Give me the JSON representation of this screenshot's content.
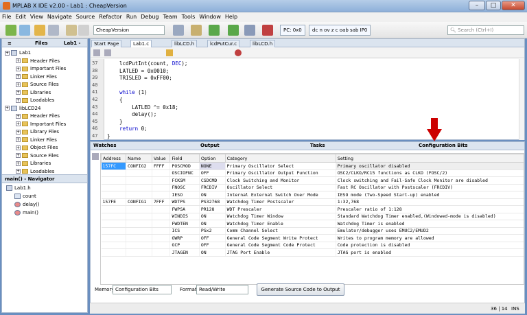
{
  "window": {
    "title": "MPLAB X IDE v2.00 - Lab1 : CheapVersion"
  },
  "menu": [
    "File",
    "Edit",
    "View",
    "Navigate",
    "Source",
    "Refactor",
    "Run",
    "Debug",
    "Team",
    "Tools",
    "Window",
    "Help"
  ],
  "toolbar": {
    "config": "CheapVersion",
    "pc": "PC: 0x0",
    "flags": "dc n ov z c oab sab IP0",
    "search_placeholder": "Search (Ctrl+I)"
  },
  "files_pane": {
    "tabs": [
      "Files",
      "Lab1 -"
    ],
    "items": [
      {
        "label": "Lab1",
        "level": 0,
        "type": "project"
      },
      {
        "label": "Header Files",
        "level": 1
      },
      {
        "label": "Important Files",
        "level": 1
      },
      {
        "label": "Linker Files",
        "level": 1
      },
      {
        "label": "Source Files",
        "level": 1
      },
      {
        "label": "Libraries",
        "level": 1
      },
      {
        "label": "Loadables",
        "level": 1
      },
      {
        "label": "libLCD24",
        "level": 0,
        "type": "project"
      },
      {
        "label": "Header Files",
        "level": 1
      },
      {
        "label": "Important Files",
        "level": 1
      },
      {
        "label": "Library Files",
        "level": 1
      },
      {
        "label": "Linker Files",
        "level": 1
      },
      {
        "label": "Object Files",
        "level": 1
      },
      {
        "label": "Source Files",
        "level": 1
      },
      {
        "label": "Libraries",
        "level": 1
      },
      {
        "label": "Loadables",
        "level": 1
      }
    ]
  },
  "navigator": {
    "title": "main() - Navigator",
    "items": [
      "Lab1.h",
      "count",
      "delay()",
      "main()"
    ]
  },
  "editor": {
    "tabs": [
      "Start Page",
      "Lab1.c",
      "libLCD.h",
      "lcdPutCur.c",
      "libLCD.h"
    ],
    "lines": [
      {
        "n": "37",
        "code": "    lcdPutInt(count, DEC);"
      },
      {
        "n": "38",
        "code": "    LATLED = 0x0010;"
      },
      {
        "n": "39",
        "code": "    TRISLED = 0xFF00;"
      },
      {
        "n": "40",
        "code": ""
      },
      {
        "n": "41",
        "code": "    while (1)"
      },
      {
        "n": "42",
        "code": "    {"
      },
      {
        "n": "43",
        "code": "        LATLED ^= 0x18;"
      },
      {
        "n": "44",
        "code": "        delay();"
      },
      {
        "n": "45",
        "code": "    }"
      },
      {
        "n": "46",
        "code": "    return 0;"
      },
      {
        "n": "47",
        "code": "}"
      }
    ]
  },
  "bottom": {
    "tabs": [
      "Watches",
      "Output",
      "Tasks",
      "Configuration Bits"
    ],
    "columns": [
      "Address",
      "Name",
      "Value",
      "Field",
      "Option",
      "Category",
      "Setting"
    ],
    "rows": [
      [
        "157FC",
        "CONFIG2",
        "FFFF",
        "POSCMOD",
        "NONE",
        "Primary Oscillator Select",
        "Primary oscillator disabled"
      ],
      [
        "",
        "",
        "",
        "OSCIOFNC",
        "OFF",
        "Primary Oscillator Output Function",
        "OSC2/CLKO/RC15 functions as CLKO (FOSC/2)"
      ],
      [
        "",
        "",
        "",
        "FCKSM",
        "CSDCMD",
        "Clock Switching and Monitor",
        "Clock switching and Fail-Safe Clock Monitor are disabled"
      ],
      [
        "",
        "",
        "",
        "FNOSC",
        "FRCDIV",
        "Oscillator Select",
        "Fast RC Oscillator with Postscaler (FRCDIV)"
      ],
      [
        "",
        "",
        "",
        "IESO",
        "ON",
        "Internal External Switch Over Mode",
        "IESO mode (Two-Speed Start-up) enabled"
      ],
      [
        "157FE",
        "CONFIG1",
        "7FFF",
        "WDTPS",
        "PS32768",
        "Watchdog Timer Postscaler",
        "1:32,768"
      ],
      [
        "",
        "",
        "",
        "FWPSA",
        "PR128",
        "WDT Prescaler",
        "Prescaler ratio of 1:128"
      ],
      [
        "",
        "",
        "",
        "WINDIS",
        "ON",
        "Watchdog Timer Window",
        "Standard Watchdog Timer enabled,(Windowed-mode is disabled)"
      ],
      [
        "",
        "",
        "",
        "FWDTEN",
        "ON",
        "Watchdog Timer Enable",
        "Watchdog Timer is enabled"
      ],
      [
        "",
        "",
        "",
        "ICS",
        "PGx2",
        "Comm Channel Select",
        "Emulator/debugger uses EMUC2/EMUD2"
      ],
      [
        "",
        "",
        "",
        "GWRP",
        "OFF",
        "General Code Segment Write Protect",
        "Writes to program memory are allowed"
      ],
      [
        "",
        "",
        "",
        "GCP",
        "OFF",
        "General Code Segment Code Protect",
        "Code protection is disabled"
      ],
      [
        "",
        "",
        "",
        "JTAGEN",
        "ON",
        "JTAG Port Enable",
        "JTAG port is enabled"
      ]
    ],
    "memory_label": "Memory",
    "memory_value": "Configuration Bits",
    "format_label": "Format",
    "format_value": "Read/Write",
    "generate_button": "Generate Source Code to Output"
  },
  "status": {
    "position": "36 | 14",
    "mode": "INS"
  },
  "colors": {
    "accent": "#3399ff",
    "arrow": "#cc0000"
  }
}
